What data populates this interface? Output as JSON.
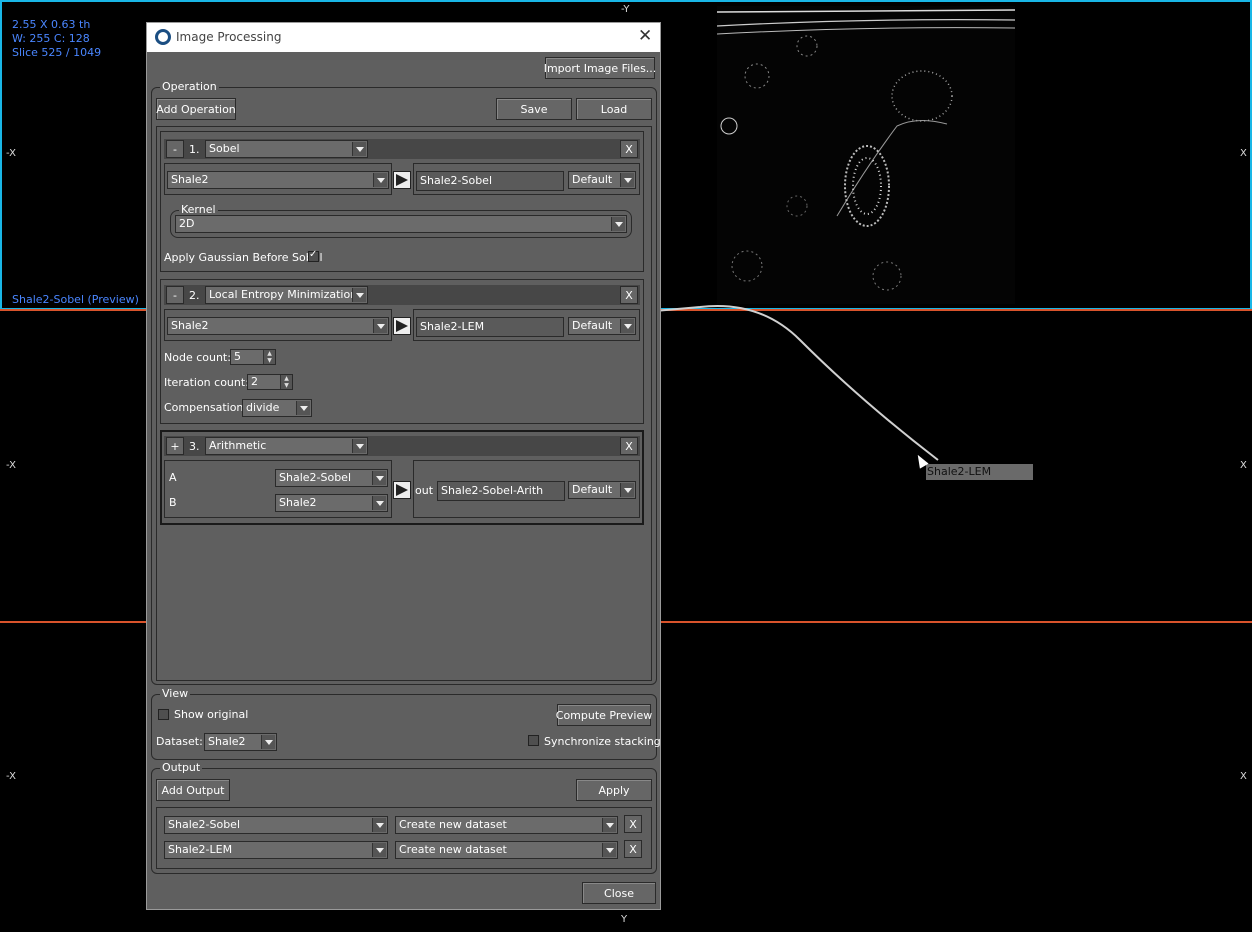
{
  "viewport": {
    "info_lines": [
      "2.55 X 0.63 th",
      "W: 255 C: 128",
      "Slice 525 / 1049"
    ],
    "caption": "Shale2-Sobel (Preview)",
    "axis_top": "-Y",
    "axis_bottom": "Y",
    "axis_left": "-X",
    "axis_right": "X",
    "drag_tooltip": "Shale2-LEM",
    "colors": {
      "frame": "#19b6e6",
      "divider": "#d9532b",
      "info": "#4a86ff"
    }
  },
  "dialog": {
    "title": "Image Processing",
    "close_glyph": "✕",
    "import_button": "Import Image Files...",
    "operation": {
      "group_label": "Operation",
      "add_button": "Add Operation",
      "save_button": "Save",
      "load_button": "Load",
      "ops": [
        {
          "toggle": "-",
          "index": "1.",
          "type": "Sobel",
          "remove": "X",
          "input": "Shale2",
          "output": "Shale2-Sobel",
          "output_mode": "Default",
          "kernel_label": "Kernel",
          "kernel_value": "2D",
          "gaussian_label": "Apply Gaussian Before Sobel",
          "gaussian_checked": true
        },
        {
          "toggle": "-",
          "index": "2.",
          "type": "Local Entropy Minimization",
          "remove": "X",
          "input": "Shale2",
          "output": "Shale2-LEM",
          "output_mode": "Default",
          "node_count_label": "Node count:",
          "node_count": "5",
          "iteration_count_label": "Iteration count:",
          "iteration_count": "2",
          "compensation_label": "Compensation:",
          "compensation": "divide"
        },
        {
          "toggle": "+",
          "index": "3.",
          "type": "Arithmetic",
          "remove": "X",
          "a_label": "A",
          "a_value": "Shale2-Sobel",
          "b_label": "B",
          "b_value": "Shale2",
          "out_label": "out",
          "output": "Shale2-Sobel-Arith",
          "output_mode": "Default"
        }
      ]
    },
    "view": {
      "group_label": "View",
      "show_original_label": "Show original",
      "compute_preview_button": "Compute Preview",
      "dataset_label": "Dataset:",
      "dataset_value": "Shale2",
      "sync_label": "Synchronize stacking"
    },
    "output": {
      "group_label": "Output",
      "add_button": "Add Output",
      "apply_button": "Apply",
      "rows": [
        {
          "source": "Shale2-Sobel",
          "target": "Create new dataset",
          "remove": "X"
        },
        {
          "source": "Shale2-LEM",
          "target": "Create new dataset",
          "remove": "X"
        }
      ]
    },
    "close_button": "Close"
  }
}
